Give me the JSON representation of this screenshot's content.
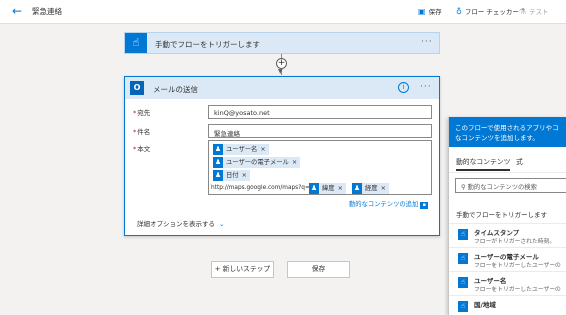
{
  "header": {
    "back_glyph": "←",
    "title": "緊急連絡",
    "save_label": "保存",
    "flow_checker_label": "フロー チェッカー",
    "test_label": "テスト"
  },
  "trigger": {
    "title": "手動でフローをトリガーします",
    "menu": "···"
  },
  "mail_card": {
    "logo": "O",
    "title": "メールの送信",
    "info_glyph": "i",
    "menu": "···",
    "to_label": "宛先",
    "to_value": "kinQ@yosato.net",
    "subject_label": "件名",
    "subject_value": "緊急連絡",
    "body_label": "本文",
    "tokens": [
      {
        "label": "ユーザー名"
      },
      {
        "label": "ユーザーの電子メール"
      },
      {
        "label": "日付"
      }
    ],
    "url_text": "http://maps.google.com/maps?q=",
    "url_tokens": [
      {
        "label": "緯度"
      },
      {
        "label": "経度"
      }
    ],
    "remove_glyph": "×",
    "dynamic_link": "動的なコンテンツの追加",
    "advanced_options": "詳細オプションを表示する"
  },
  "actions": {
    "new_step": "+ 新しいステップ",
    "save": "保存"
  },
  "panel": {
    "header_line1": "このフローで使用されるアプリやコ",
    "header_line2": "なコンテンツを追加します。",
    "tab_dynamic": "動的なコンテンツ",
    "tab_expression": "式",
    "search_placeholder": "動的なコンテンツの検索",
    "section_title": "手動でフローをトリガーします",
    "items": [
      {
        "title": "タイムスタンプ",
        "desc": "フローがトリガーされた時刻。"
      },
      {
        "title": "ユーザーの電子メール",
        "desc": "フローをトリガーしたユーザーの"
      },
      {
        "title": "ユーザー名",
        "desc": "フローをトリガーしたユーザーの"
      },
      {
        "title": "国/地域",
        "desc": ""
      }
    ]
  },
  "colors": {
    "accent": "#0078d4",
    "trigger_bg": "#dbe9f6",
    "required": "#a4262c"
  },
  "icons": {
    "back": "arrow-left-icon",
    "save": "save-icon",
    "flow_checker": "stethoscope-icon",
    "test": "flask-icon",
    "trigger": "hand-touch-icon",
    "outlook": "outlook-icon",
    "token": "person-icon"
  }
}
